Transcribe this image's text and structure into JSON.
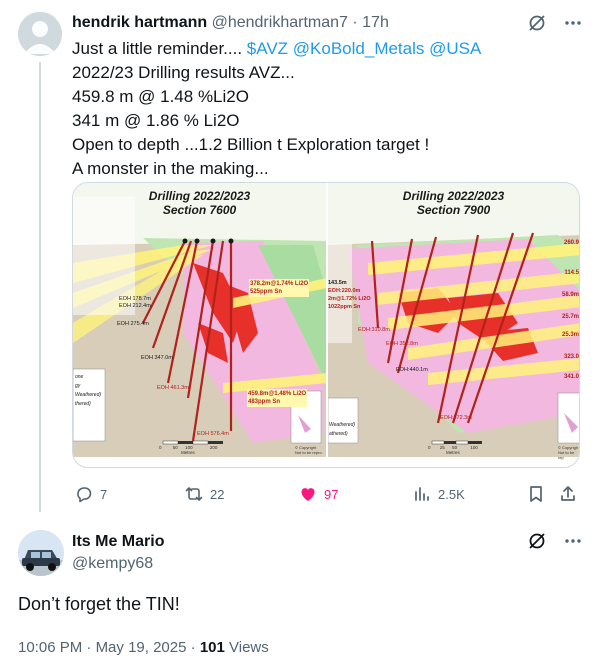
{
  "tweet": {
    "display_name": "hendrik hartmann",
    "handle": "@hendrikhartman7",
    "separator": "·",
    "time": "17h",
    "lines": {
      "l1_prefix": "Just a little reminder.... ",
      "l1_cashtag": "$AVZ",
      "l1_mentions": "  @KoBold_Metals @USA",
      "l2": "2022/23 Drilling results AVZ...",
      "l3": "459.8 m @ 1.48 %Li2O",
      "l4": "341 m @ 1.86 % Li2O",
      "l5": "Open to depth ...1.2 Billion t Exploration target !",
      "l6": "A monster in the making..."
    },
    "media": {
      "left": {
        "title_line1": "Drilling 2022/2023",
        "title_line2": "Section 7600",
        "callouts": [
          "378.2m@1.74% Li2O",
          "525ppm Sn",
          "459.8m@1.48% Li2O",
          "483ppm Sn"
        ],
        "eoh_labels": [
          "EOH 178.7m",
          "EOH 212.4m",
          "EOH 275.4m",
          "EOH 347.0m",
          "EOH 461.3m",
          "EOH 576.4m"
        ],
        "legend": [
          "one",
          "gy",
          "Weathered)",
          "thered)"
        ],
        "scale_ticks": [
          "0",
          "50",
          "100",
          "200"
        ],
        "scale_unit": "Metres",
        "copyright": "© Copyright",
        "not_for_repro": "Not to be repro"
      },
      "right": {
        "title_line1": "Drilling 2022/2023",
        "title_line2": "Section 7900",
        "callouts": [
          "260.9",
          "114.5",
          "58.9m",
          "25.7m",
          "25.3m",
          "323.0",
          "341.0"
        ],
        "eoh_labels": [
          "EOH 352.8m",
          "EOH:440.1m",
          "EOH:572.3m",
          "EOH:310.8m"
        ],
        "left_labels": [
          "EOH:220.0m",
          "2m@1.72% Li2O",
          "1022ppm Sn",
          "143.5m"
        ],
        "legend": [
          "Weathered)",
          "athered)"
        ],
        "scale_ticks": [
          "0",
          "25",
          "50",
          "100"
        ],
        "scale_unit": "Metres",
        "copyright": "© Copyrigh",
        "not_for_repro": "Not to be rep"
      }
    },
    "actions": {
      "replies": "7",
      "reposts": "22",
      "likes": "97",
      "views": "2.5K"
    }
  },
  "reply": {
    "display_name": "Its Me Mario",
    "handle": "@kempy68",
    "text": "Don’t forget the TIN!",
    "time": "10:06 PM",
    "separator": " · ",
    "date": "May 19, 2025",
    "views_count": "101",
    "views_label": " Views"
  },
  "colors": {
    "accent": "#1d9bf0",
    "like": "#f91880",
    "secondary_text": "#536471",
    "pegmatite_pink": "#f2b8e0",
    "orebody_red": "#e8302a",
    "drillhole": "#b0221a",
    "callout_yellow": "#fff27a"
  }
}
